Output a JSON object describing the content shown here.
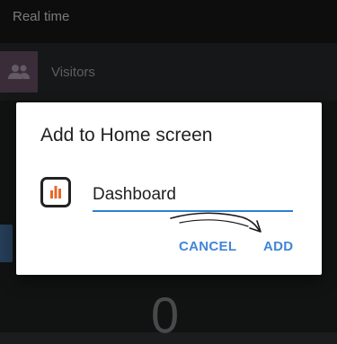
{
  "background": {
    "header_title": "Real time",
    "visitors_label": "Visitors",
    "counter_value": "0",
    "icons": {
      "visitors": "people-icon",
      "side": "message-icon"
    }
  },
  "dialog": {
    "title": "Add to Home screen",
    "app_icon": "bar-chart-app-icon",
    "name_value": "Dashboard",
    "cancel_label": "CANCEL",
    "add_label": "ADD",
    "colors": {
      "accent": "#3f86d8",
      "icon_bars": "#e8672a"
    }
  }
}
